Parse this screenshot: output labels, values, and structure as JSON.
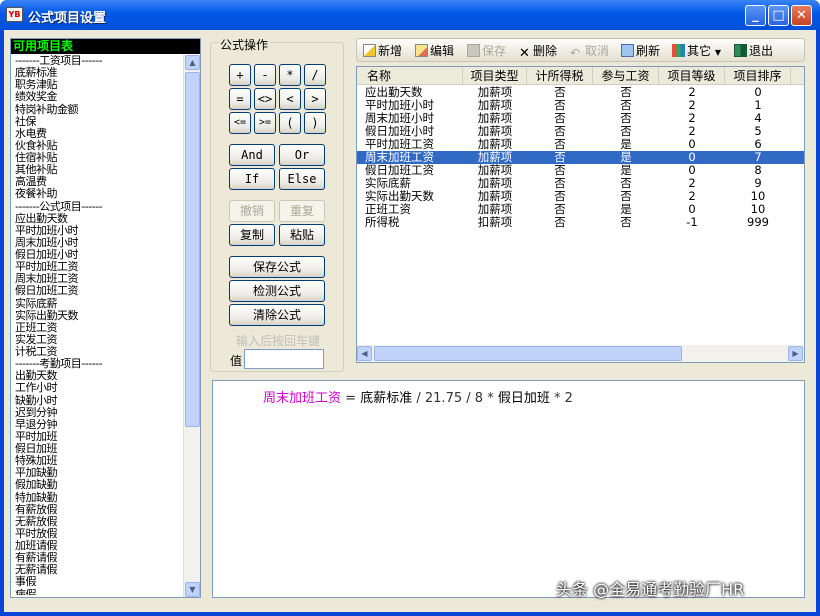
{
  "window": {
    "title": "公式项目设置",
    "app_icon": "YB"
  },
  "left": {
    "header": "可用项目表",
    "items": [
      "-------工资项目------",
      "底薪标准",
      "职务津贴",
      "绩效奖金",
      "特岗补助金额",
      "社保",
      "水电费",
      "伙食补贴",
      "住宿补贴",
      "其他补贴",
      "高温费",
      "夜餐补助",
      "-------公式项目------",
      "应出勤天数",
      "平时加班小时",
      "周末加班小时",
      "假日加班小时",
      "平时加班工资",
      "周末加班工资",
      "假日加班工资",
      "实际底薪",
      "实际出勤天数",
      "正班工资",
      "实发工资",
      "计税工资",
      "-------考勤项目------",
      "出勤天数",
      "工作小时",
      "缺勤小时",
      "迟到分钟",
      "早退分钟",
      "平时加班",
      "假日加班",
      "特殊加班",
      "平加缺勤",
      "假加缺勤",
      "特加缺勤",
      "有薪放假",
      "无薪放假",
      "平时放假",
      "加班请假",
      "有薪请假",
      "无薪请假",
      "事假",
      "病假"
    ]
  },
  "ops": {
    "title": "公式操作",
    "operators_row1": [
      "+",
      "-",
      "*",
      "/"
    ],
    "operators_row2": [
      "=",
      "<>",
      "<",
      ">"
    ],
    "operators_row3": [
      "<=",
      ">=",
      "(",
      ")"
    ],
    "and": "And",
    "or": "Or",
    "if": "If",
    "else": "Else",
    "undo": "撤销",
    "redo": "重复",
    "copy": "复制",
    "paste": "粘贴",
    "save_formula": "保存公式",
    "check_formula": "检测公式",
    "clear_formula": "清除公式",
    "hint": "输入后按回车键",
    "value_label": "值",
    "value_input": ""
  },
  "toolbar": {
    "new": "新增",
    "edit": "编辑",
    "save": "保存",
    "delete": "删除",
    "cancel": "取消",
    "refresh": "刷新",
    "other": "其它",
    "exit": "退出"
  },
  "table": {
    "columns": [
      "名称",
      "项目类型",
      "计所得税",
      "参与工资",
      "项目等级",
      "项目排序"
    ],
    "selected_row": 5,
    "rows": [
      [
        "应出勤天数",
        "加薪项",
        "否",
        "否",
        "2",
        "0"
      ],
      [
        "平时加班小时",
        "加薪项",
        "否",
        "否",
        "2",
        "1"
      ],
      [
        "周末加班小时",
        "加薪项",
        "否",
        "否",
        "2",
        "4"
      ],
      [
        "假日加班小时",
        "加薪项",
        "否",
        "否",
        "2",
        "5"
      ],
      [
        "平时加班工资",
        "加薪项",
        "否",
        "是",
        "0",
        "6"
      ],
      [
        "周末加班工资",
        "加薪项",
        "否",
        "是",
        "0",
        "7"
      ],
      [
        "假日加班工资",
        "加薪项",
        "否",
        "是",
        "0",
        "8"
      ],
      [
        "实际底薪",
        "加薪项",
        "否",
        "否",
        "2",
        "9"
      ],
      [
        "实际出勤天数",
        "加薪项",
        "否",
        "否",
        "2",
        "10"
      ],
      [
        "正班工资",
        "加薪项",
        "否",
        "是",
        "0",
        "10"
      ],
      [
        "所得税",
        "扣薪项",
        "否",
        "否",
        "-1",
        "999"
      ]
    ]
  },
  "formula": {
    "target": "周末加班工资",
    "eq": "=",
    "t1": "底薪标准",
    "op1": "/",
    "n1": "21.75",
    "op2": "/",
    "n2": "8",
    "op3": "*",
    "t2": "假日加班",
    "op4": "*",
    "n3": "2"
  },
  "watermark": "头条 @全易通考勤验厂HR"
}
